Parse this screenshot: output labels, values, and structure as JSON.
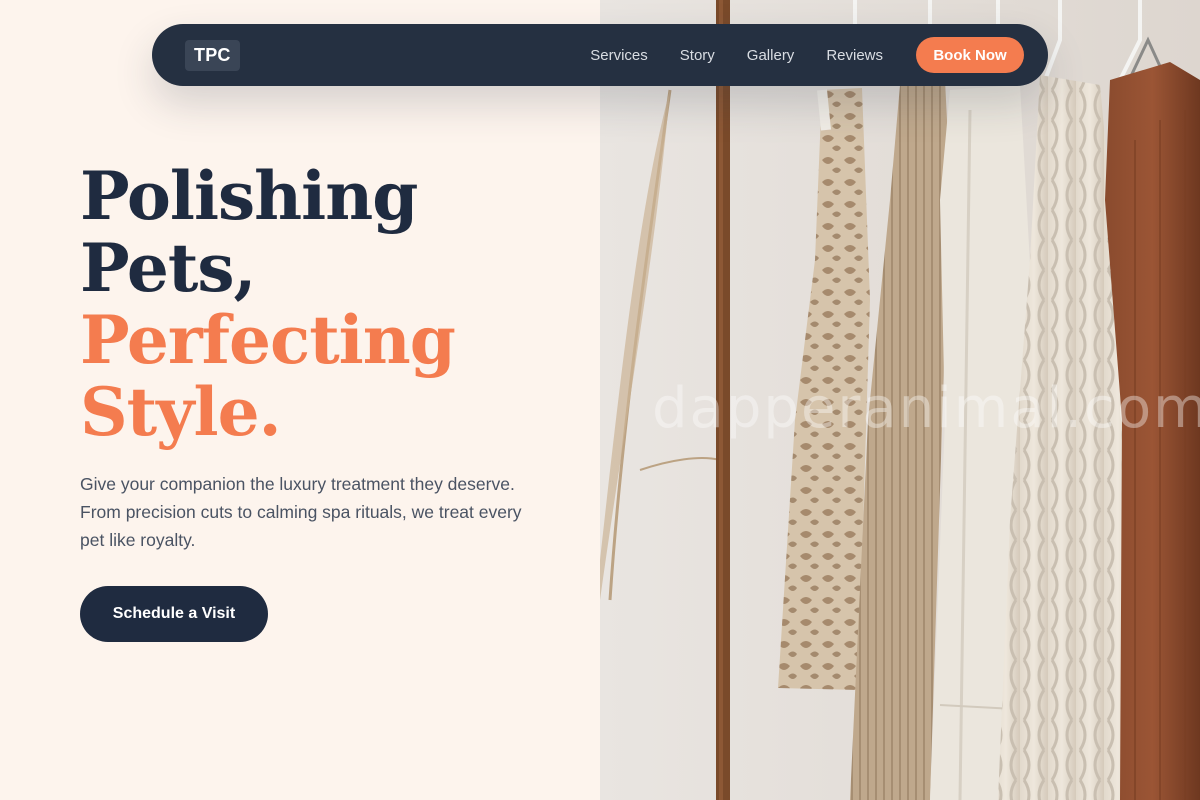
{
  "nav": {
    "logo": "TPC",
    "links": [
      "Services",
      "Story",
      "Gallery",
      "Reviews"
    ],
    "cta_label": "Book Now"
  },
  "hero": {
    "headline_lines_dark": [
      "Polishing",
      "Pets,"
    ],
    "headline_lines_accent": [
      "Perfecting",
      "Style."
    ],
    "description": "Give your companion the luxury treatment they deserve. From precision cuts to calming spa rituals, we treat every pet like royalty.",
    "cta_label": "Schedule a Visit",
    "image_watermark": "dapperanimal.com"
  },
  "colors": {
    "background": "#fdf4ed",
    "navy": "#1f2b40",
    "nav_bg": "#253041",
    "accent": "#f47c4f"
  }
}
